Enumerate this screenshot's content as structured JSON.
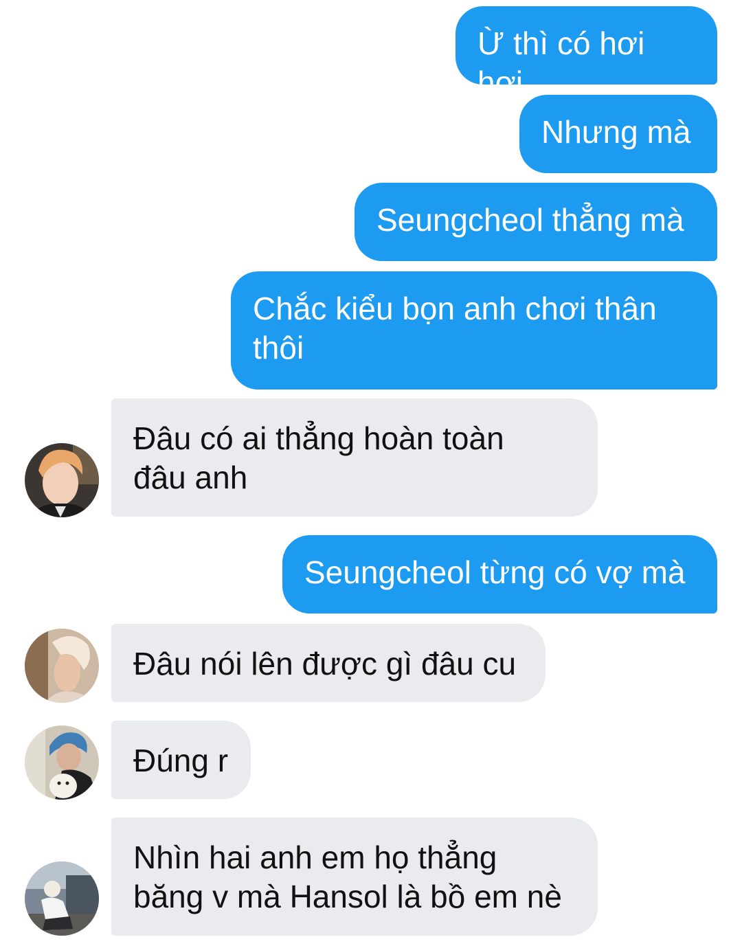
{
  "conversation": {
    "messages": [
      {
        "direction": "outgoing",
        "text": "Ừ thì có hơi hơi"
      },
      {
        "direction": "outgoing",
        "text": "Nhưng mà"
      },
      {
        "direction": "outgoing",
        "text": "Seungcheol thẳng mà"
      },
      {
        "direction": "outgoing",
        "text": "Chắc kiểu bọn anh chơi thân\nthôi"
      },
      {
        "direction": "incoming",
        "text": "Đâu có ai thẳng hoàn toàn\nđâu anh",
        "avatar": "avatar-blonde-suit"
      },
      {
        "direction": "outgoing",
        "text": "Seungcheol từng có vợ mà"
      },
      {
        "direction": "incoming",
        "text": "Đâu nói lên được gì đâu cu",
        "avatar": "avatar-light-hair-profile"
      },
      {
        "direction": "incoming",
        "text": "Đúng r",
        "avatar": "avatar-blue-hair-puppy"
      },
      {
        "direction": "incoming",
        "text": "Nhìn hai anh em họ thẳng\nbăng v mà Hansol là bồ em nè",
        "avatar": "avatar-crouching-outdoor"
      }
    ]
  },
  "colors": {
    "outgoing_bubble": "#1d9bf0",
    "incoming_bubble": "#e9ebef",
    "background": "#ffffff"
  }
}
